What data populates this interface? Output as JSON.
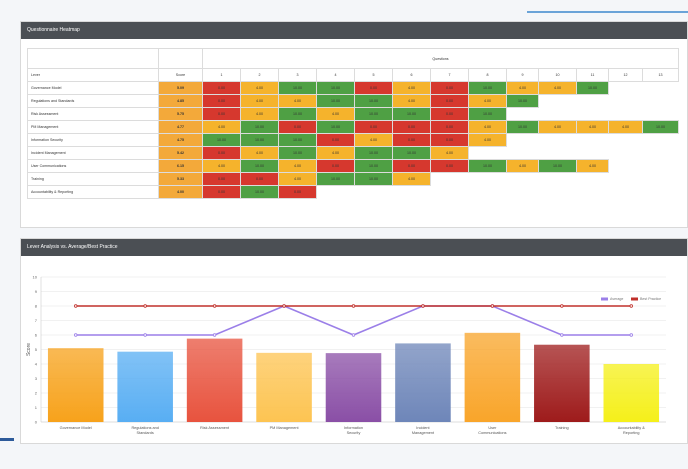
{
  "heatmap": {
    "title": "Questionnaire Heatmap",
    "questions_label": "Questions",
    "lever_header": "Lever",
    "score_header": "Score",
    "question_numbers": [
      "1",
      "2",
      "3",
      "4",
      "5",
      "6",
      "7",
      "8",
      "9",
      "10",
      "11",
      "12",
      "13"
    ],
    "rows": [
      {
        "lever": "Governance Model",
        "score": "5.09",
        "cells": [
          [
            "0.00",
            "red"
          ],
          [
            "4.00",
            "orange"
          ],
          [
            "10.00",
            "green"
          ],
          [
            "10.00",
            "green"
          ],
          [
            "0.00",
            "red"
          ],
          [
            "4.00",
            "orange"
          ],
          [
            "0.00",
            "red"
          ],
          [
            "10.00",
            "green"
          ],
          [
            "4.00",
            "orange"
          ],
          [
            "4.00",
            "orange"
          ],
          [
            "10.00",
            "green"
          ]
        ]
      },
      {
        "lever": "Regulations and Standards",
        "score": "4.85",
        "cells": [
          [
            "0.00",
            "red"
          ],
          [
            "4.00",
            "orange"
          ],
          [
            "4.00",
            "orange"
          ],
          [
            "10.00",
            "green"
          ],
          [
            "10.00",
            "green"
          ],
          [
            "4.00",
            "orange"
          ],
          [
            "0.00",
            "red"
          ],
          [
            "4.00",
            "orange"
          ],
          [
            "10.00",
            "green"
          ]
        ]
      },
      {
        "lever": "Risk Assessment",
        "score": "5.75",
        "cells": [
          [
            "0.00",
            "red"
          ],
          [
            "4.00",
            "orange"
          ],
          [
            "10.00",
            "green"
          ],
          [
            "4.00",
            "orange"
          ],
          [
            "10.00",
            "green"
          ],
          [
            "10.00",
            "green"
          ],
          [
            "0.00",
            "red"
          ],
          [
            "10.00",
            "green"
          ]
        ]
      },
      {
        "lever": "PM Management",
        "score": "4.77",
        "cells": [
          [
            "4.00",
            "orange"
          ],
          [
            "10.00",
            "green"
          ],
          [
            "0.00",
            "red"
          ],
          [
            "10.00",
            "green"
          ],
          [
            "0.00",
            "red"
          ],
          [
            "0.00",
            "red"
          ],
          [
            "0.00",
            "red"
          ],
          [
            "4.00",
            "orange"
          ],
          [
            "10.00",
            "green"
          ],
          [
            "4.00",
            "orange"
          ],
          [
            "4.00",
            "orange"
          ],
          [
            "4.00",
            "orange"
          ],
          [
            "10.00",
            "green"
          ]
        ]
      },
      {
        "lever": "Information Security",
        "score": "4.75",
        "cells": [
          [
            "10.00",
            "green"
          ],
          [
            "10.00",
            "green"
          ],
          [
            "10.00",
            "green"
          ],
          [
            "0.00",
            "red"
          ],
          [
            "4.00",
            "orange"
          ],
          [
            "0.00",
            "red"
          ],
          [
            "0.00",
            "red"
          ],
          [
            "4.00",
            "orange"
          ]
        ]
      },
      {
        "lever": "Incident Management",
        "score": "5.42",
        "cells": [
          [
            "0.00",
            "red"
          ],
          [
            "4.00",
            "orange"
          ],
          [
            "10.00",
            "green"
          ],
          [
            "4.00",
            "orange"
          ],
          [
            "10.00",
            "green"
          ],
          [
            "10.00",
            "green"
          ],
          [
            "4.00",
            "orange"
          ]
        ]
      },
      {
        "lever": "User Communications",
        "score": "6.15",
        "cells": [
          [
            "4.00",
            "orange"
          ],
          [
            "10.00",
            "green"
          ],
          [
            "4.00",
            "orange"
          ],
          [
            "0.00",
            "red"
          ],
          [
            "10.00",
            "green"
          ],
          [
            "0.00",
            "red"
          ],
          [
            "0.00",
            "red"
          ],
          [
            "10.00",
            "green"
          ],
          [
            "4.00",
            "orange"
          ],
          [
            "10.00",
            "green"
          ],
          [
            "4.00",
            "orange"
          ]
        ]
      },
      {
        "lever": "Training",
        "score": "5.33",
        "cells": [
          [
            "0.00",
            "red"
          ],
          [
            "0.00",
            "red"
          ],
          [
            "4.00",
            "orange"
          ],
          [
            "10.00",
            "green"
          ],
          [
            "10.00",
            "green"
          ],
          [
            "4.00",
            "orange"
          ]
        ]
      },
      {
        "lever": "Accountability & Reporting",
        "score": "4.00",
        "cells": [
          [
            "0.00",
            "red"
          ],
          [
            "10.00",
            "green"
          ],
          [
            "0.00",
            "red"
          ]
        ]
      }
    ]
  },
  "chart_panel": {
    "title": "Lever Analysis vs. Average/Best Practice"
  },
  "colors": {
    "green": "#4fa044",
    "orange": "#f5b32c",
    "red": "#d6382e",
    "header": "#4b4f54",
    "average": "#9b7fe8",
    "best": "#c0302b"
  },
  "chart_data": {
    "type": "bar",
    "title": "Lever Analysis vs. Average/Best Practice",
    "ylabel": "Score",
    "xlabel": "",
    "ylim": [
      0,
      10
    ],
    "yticks": [
      "0",
      "1",
      "2",
      "3",
      "4",
      "5",
      "6",
      "7",
      "8",
      "9",
      "10"
    ],
    "categories": [
      "Governance Model",
      "Regulations and Standards",
      "Risk Assessment",
      "PM Management",
      "Information Security",
      "Incident Management",
      "User Communications",
      "Training",
      "Accountability & Reporting"
    ],
    "series": [
      {
        "name": "",
        "type": "bar",
        "values": [
          5.09,
          4.85,
          5.75,
          4.77,
          4.75,
          5.42,
          6.15,
          5.33,
          4.0
        ],
        "colors": [
          "#f7a21b",
          "#58aef3",
          "#e8533e",
          "#fdc452",
          "#8a4fa6",
          "#6e86b9",
          "#f9a52a",
          "#9e1b1b",
          "#f5f01a"
        ]
      },
      {
        "name": "Average",
        "type": "line",
        "values": [
          6,
          6,
          6,
          8,
          6,
          8,
          8,
          6,
          6
        ]
      },
      {
        "name": "Best Practice",
        "type": "line",
        "values": [
          8,
          8,
          8,
          8,
          8,
          8,
          8,
          8,
          8
        ]
      }
    ],
    "legend_position": "top-right",
    "grid": true
  }
}
